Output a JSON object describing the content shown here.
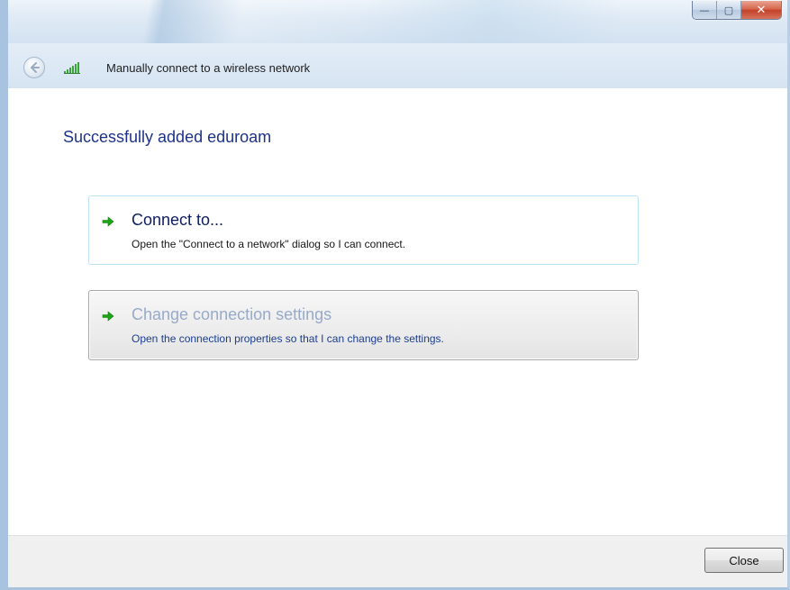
{
  "window": {
    "title": "Manually connect to a wireless network",
    "caption_buttons": {
      "minimize_glyph": "—",
      "maximize_glyph": "▢",
      "close_glyph": "✕"
    },
    "icons": {
      "back": "back-arrow-icon",
      "network": "wireless-signal-icon"
    }
  },
  "content": {
    "heading": "Successfully added eduroam",
    "commands": [
      {
        "title": "Connect to...",
        "description": "Open the \"Connect to a network\" dialog so I can connect.",
        "icon": "green-arrow-icon"
      },
      {
        "title": "Change connection settings",
        "description": "Open the connection properties so that I can change the settings.",
        "icon": "green-arrow-icon"
      }
    ]
  },
  "footer": {
    "close_label": "Close"
  },
  "colors": {
    "heading": "#1e3287",
    "link_title": "#102060",
    "link_title_hover": "#97aac8",
    "link_desc_hover": "#1b3d91",
    "arrow_green": "#1fa319",
    "frame_glass": "#dfeaf5"
  }
}
